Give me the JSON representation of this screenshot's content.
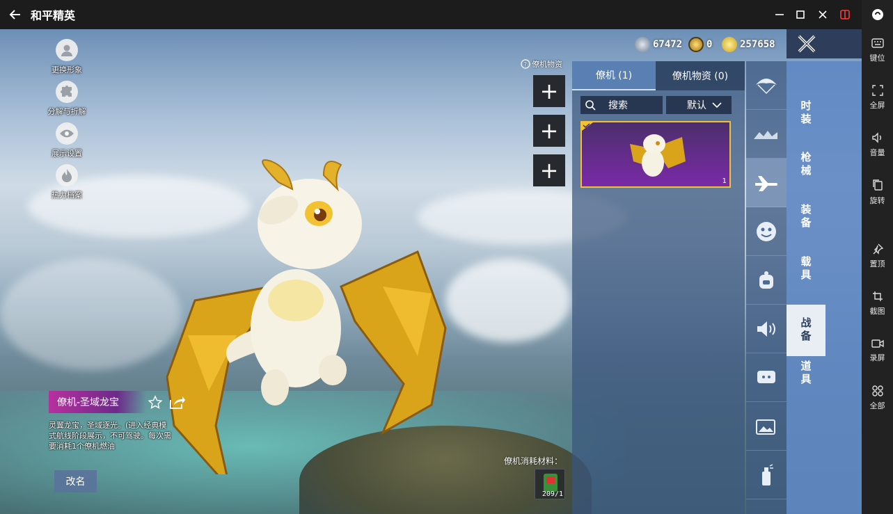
{
  "window": {
    "title": "和平精英"
  },
  "emulator_sidebar": {
    "items": [
      {
        "label": "键位",
        "icon": "keyboard-icon"
      },
      {
        "label": "全屏",
        "icon": "fullscreen-icon"
      },
      {
        "label": "音量",
        "icon": "volume-icon"
      },
      {
        "label": "旋转",
        "icon": "rotate-icon"
      },
      {
        "label": "置顶",
        "icon": "pin-icon"
      },
      {
        "label": "截图",
        "icon": "crop-icon"
      },
      {
        "label": "录屏",
        "icon": "record-icon"
      },
      {
        "label": "全部",
        "icon": "grid-icon"
      }
    ]
  },
  "left_menu": {
    "items": [
      {
        "label": "更换形象",
        "icon": "avatar-icon"
      },
      {
        "label": "分解与折解",
        "icon": "puzzle-icon"
      },
      {
        "label": "展示设置",
        "icon": "eye-icon"
      },
      {
        "label": "热力档案",
        "icon": "flame-icon"
      }
    ]
  },
  "currencies": [
    {
      "amount": "67472",
      "icon": "silver-coin-icon"
    },
    {
      "amount": "0",
      "icon": "gold-token-icon"
    },
    {
      "amount": "257658",
      "icon": "bp-coin-icon"
    }
  ],
  "assets_link": "僚机物资",
  "inventory": {
    "tabs": [
      "僚机 (1)",
      "僚机物资 (0)"
    ],
    "search_label": "搜索",
    "sort_label": "默认",
    "item_count": "1"
  },
  "category_icons": [
    "parachute-icon",
    "vehicle-wreck-icon",
    "plane-icon",
    "emote-icon",
    "backpack-icon",
    "speaker-icon",
    "chat-bubble-icon",
    "gallery-icon",
    "spray-icon"
  ],
  "category_tabs": [
    "时装",
    "枪械",
    "装备",
    "载具",
    "战备",
    "道具"
  ],
  "active_category": "战备",
  "pet": {
    "name": "僚机-圣域龙宝",
    "description": "灵翼龙宝，圣域逐光。(进入经典模式航线阶段展示，不可驾驶。每次需要消耗1个僚机燃油",
    "rename_label": "改名",
    "consume_label": "僚机消耗材料：",
    "consume_count": "209/1"
  },
  "colors": {
    "accent_gold": "#f2c233",
    "tab_active": "#e9eef5",
    "panel_blue": "#5f87c3"
  }
}
